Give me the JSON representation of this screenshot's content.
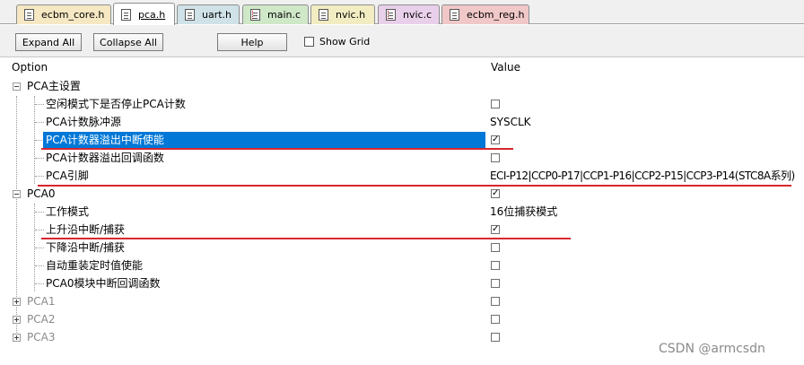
{
  "tabs": [
    {
      "label": "ecbm_core.h",
      "type": "h"
    },
    {
      "label": "pca.h",
      "type": "h"
    },
    {
      "label": "uart.h",
      "type": "h"
    },
    {
      "label": "main.c",
      "type": "c"
    },
    {
      "label": "nvic.h",
      "type": "h"
    },
    {
      "label": "nvic.c",
      "type": "c"
    },
    {
      "label": "ecbm_reg.h",
      "type": "h"
    }
  ],
  "toolbar": {
    "expand_all": "Expand All",
    "collapse_all": "Collapse All",
    "help": "Help",
    "show_grid": "Show Grid"
  },
  "grid": {
    "col_option": "Option",
    "col_value": "Value",
    "rows": [
      {
        "label": "PCA主设置",
        "value": "checkbox",
        "checked": false
      },
      {
        "label": "空闲模式下是否停止PCA计数",
        "value": "",
        "checked": false
      },
      {
        "label": "PCA计数脉冲源",
        "value": "SYSCLK"
      },
      {
        "label": "PCA计数器溢出中断使能",
        "checked": true
      },
      {
        "label": "PCA计数器溢出回调函数",
        "checked": false
      },
      {
        "label": "PCA引脚",
        "value": "ECI-P12|CCP0-P17|CCP1-P16|CCP2-P15|CCP3-P14(STC8A系列)"
      },
      {
        "label": "PCA0",
        "checked": true
      },
      {
        "label": "工作模式",
        "value": "16位捕获模式"
      },
      {
        "label": "上升沿中断/捕获",
        "checked": true
      },
      {
        "label": "下降沿中断/捕获",
        "checked": false
      },
      {
        "label": "自动重装定时值使能",
        "checked": false
      },
      {
        "label": "PCA0模块中断回调函数",
        "checked": false
      },
      {
        "label": "PCA1",
        "checked": false
      },
      {
        "label": "PCA2",
        "checked": false
      },
      {
        "label": "PCA3",
        "checked": false
      }
    ]
  },
  "check_mark": "✓",
  "watermark": "CSDN @armcsdn",
  "colors": {
    "selection": "#0078d7",
    "annotation_underline": "#d7262e",
    "tab_colors": [
      "#f6e8c3",
      "#f6e8c3",
      "#cfe2e8",
      "#cfe8c8",
      "#f2ecc2",
      "#e9d0ea",
      "#f0c8c8"
    ]
  }
}
